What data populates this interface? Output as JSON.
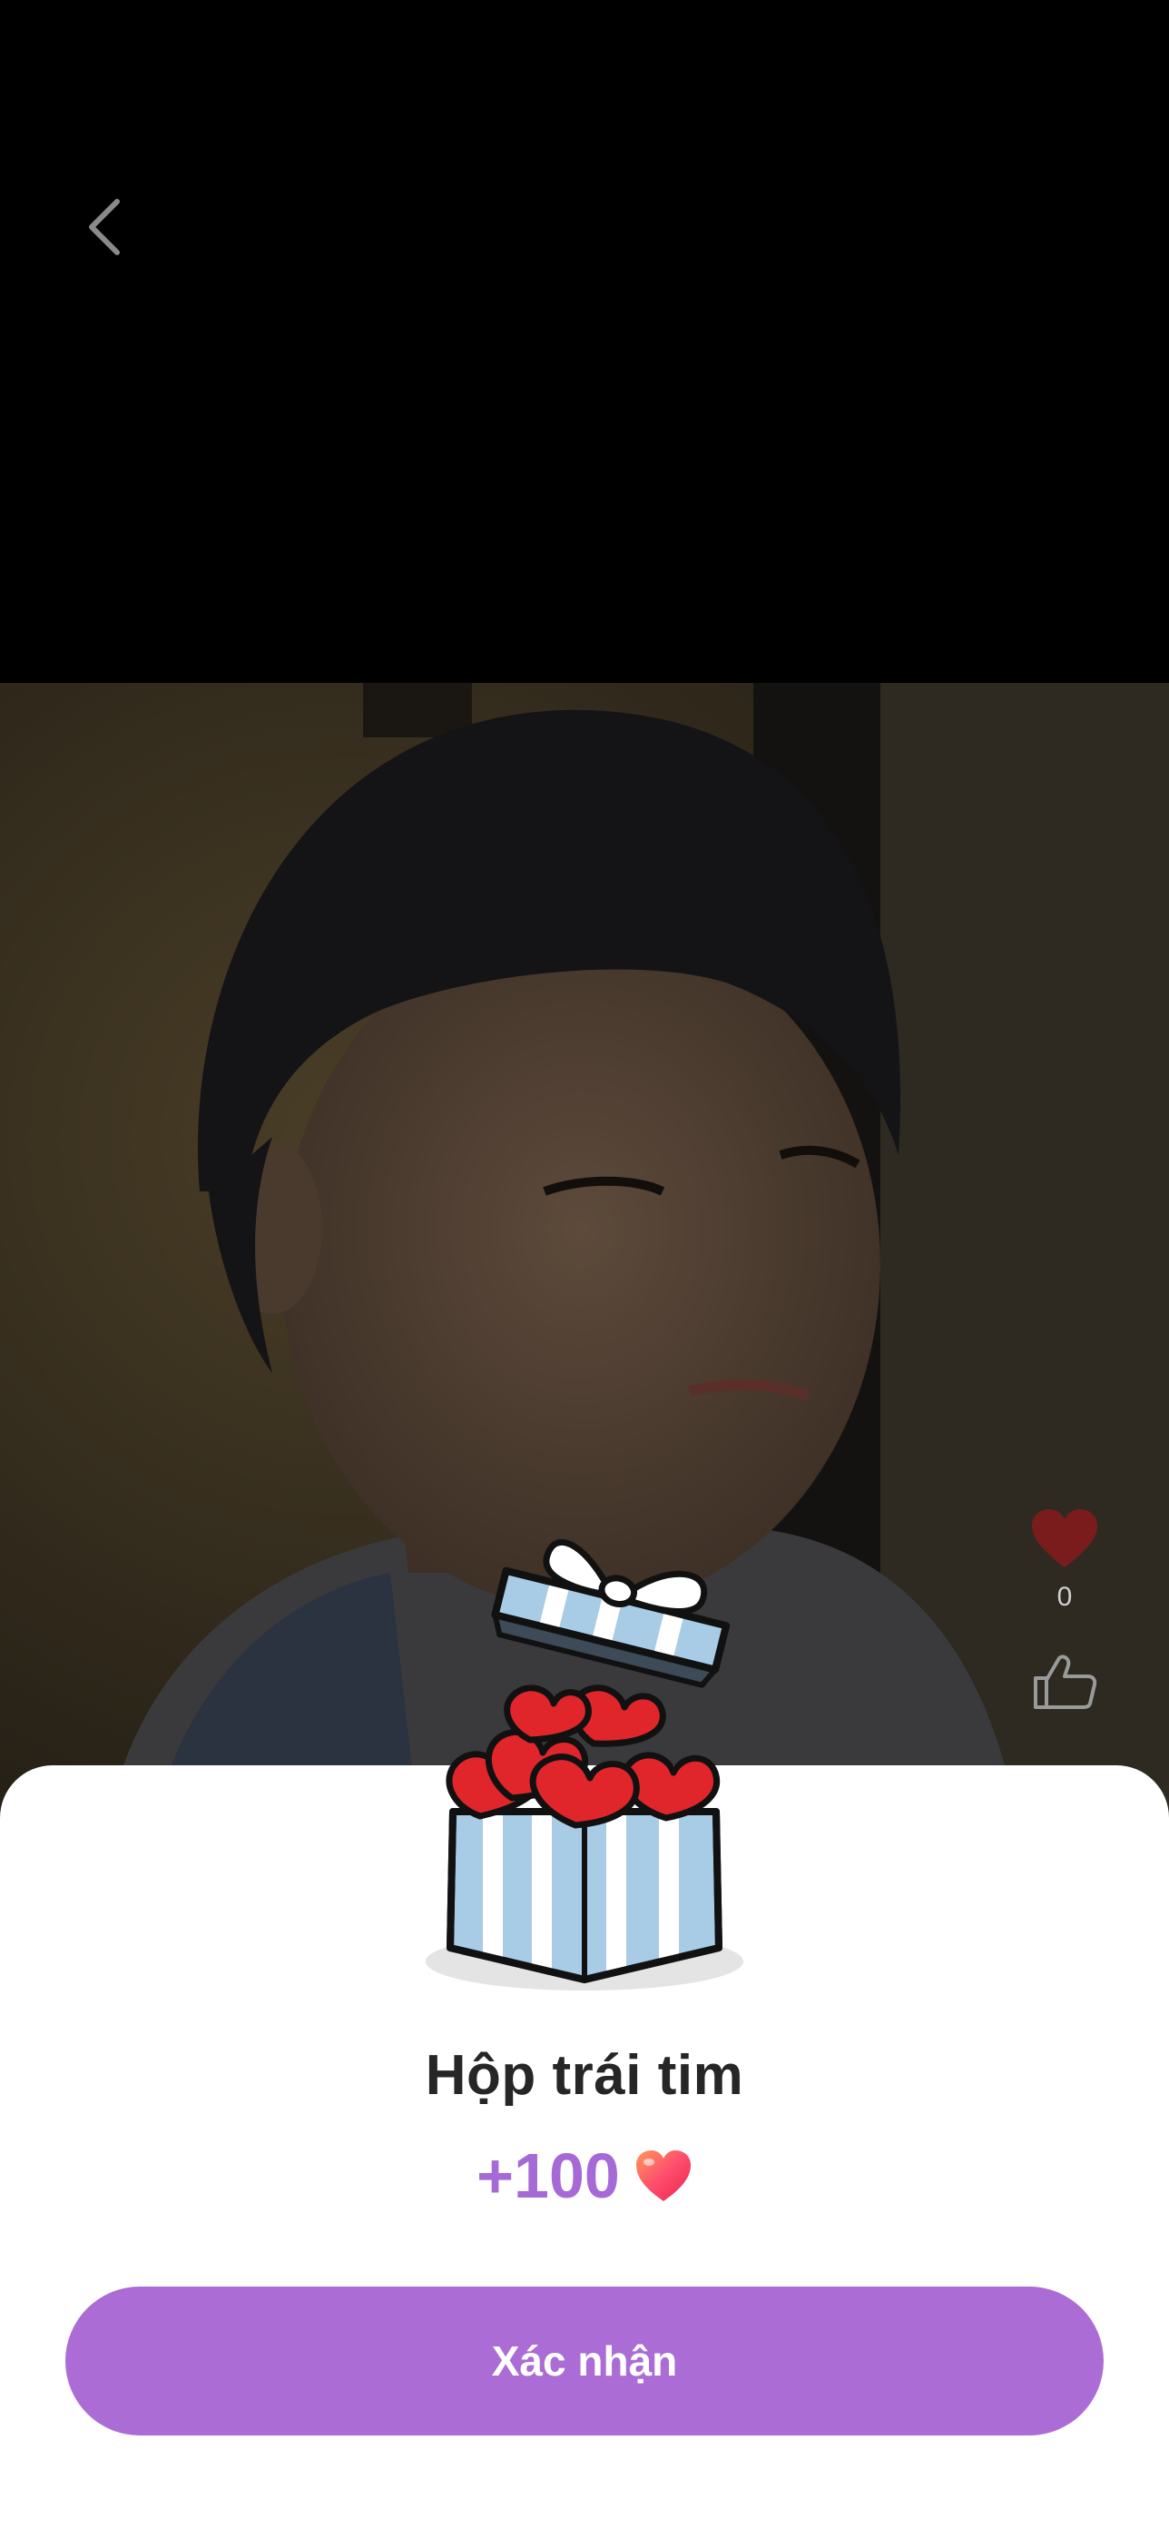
{
  "header": {
    "back_icon": "chevron-left-icon"
  },
  "video": {
    "description_icon": "video-frame"
  },
  "side_actions": {
    "heart_icon": "heart-icon",
    "like_count": "0",
    "thumb_icon": "thumbs-up-icon"
  },
  "reward": {
    "title": "Hộp trái tim",
    "amount": "+100",
    "amount_icon": "heart-icon",
    "gift_icon": "gift-box-icon",
    "accent_color": "#a66ad6"
  },
  "actions": {
    "confirm_label": "Xác nhận",
    "button_color": "#ab6dd5"
  }
}
